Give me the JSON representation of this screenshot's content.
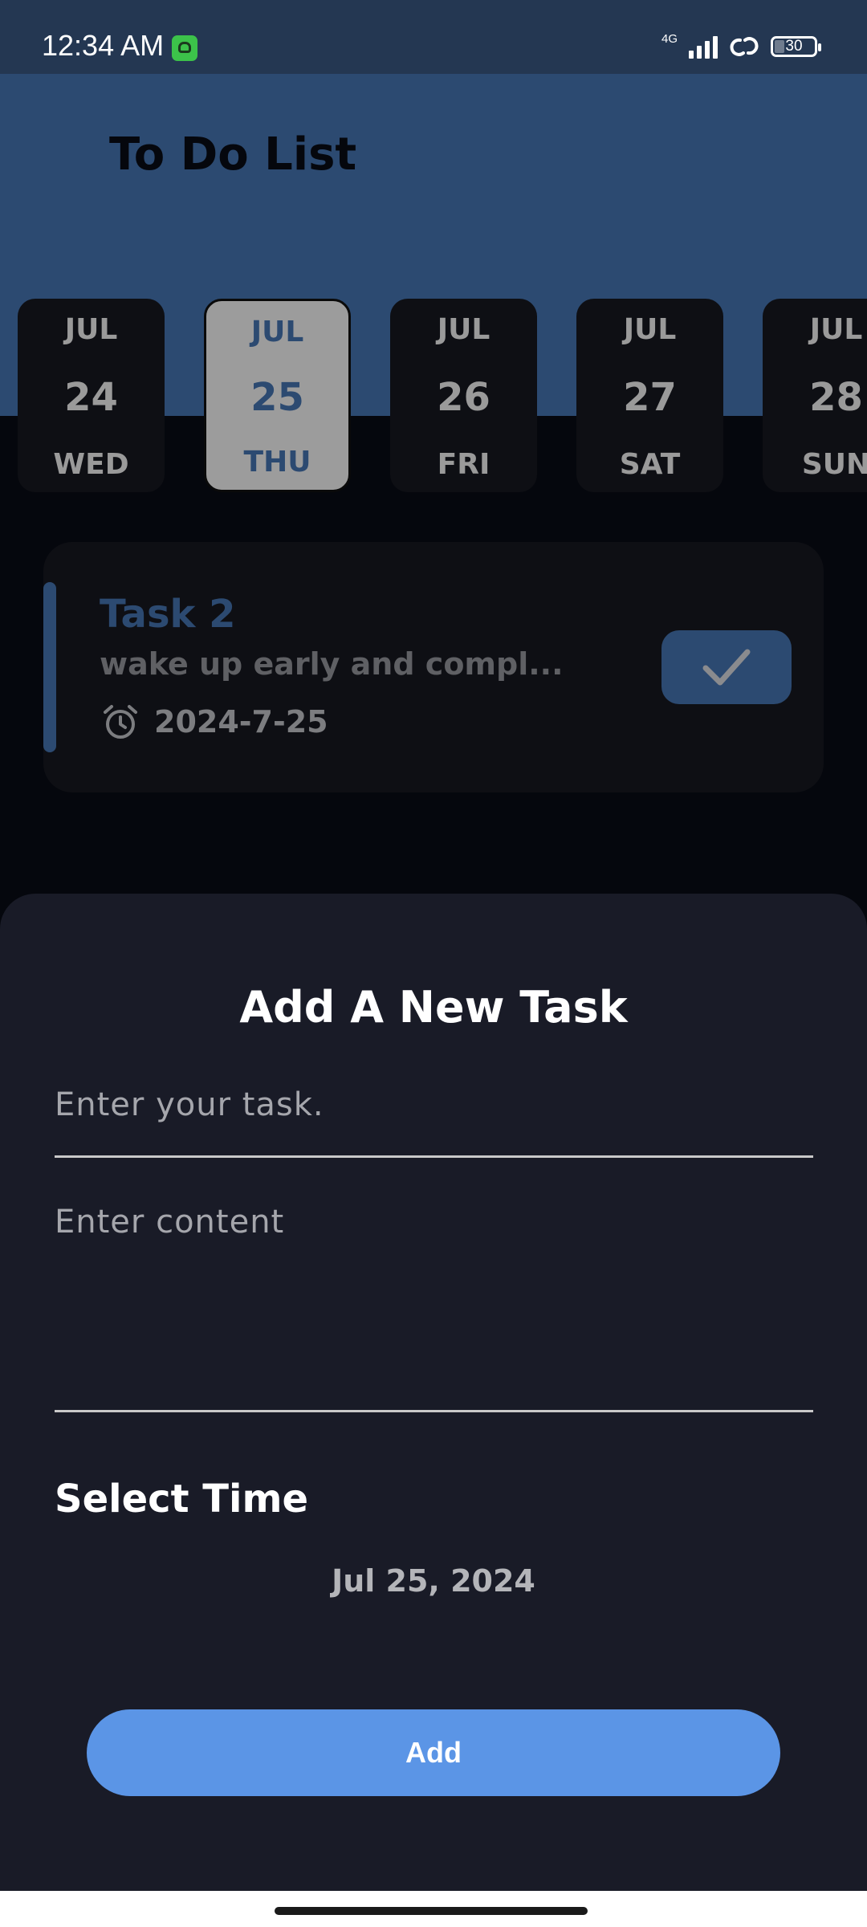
{
  "status_bar": {
    "time": "12:34 AM",
    "network": "4G",
    "battery": "30",
    "icons": [
      "app-notification-icon",
      "signal-icon",
      "link-icon",
      "battery-icon"
    ]
  },
  "header": {
    "title": "To Do List"
  },
  "dates": [
    {
      "month": "JUL",
      "day": "24",
      "weekday": "WED",
      "selected": false
    },
    {
      "month": "JUL",
      "day": "25",
      "weekday": "THU",
      "selected": true
    },
    {
      "month": "JUL",
      "day": "26",
      "weekday": "FRI",
      "selected": false
    },
    {
      "month": "JUL",
      "day": "27",
      "weekday": "SAT",
      "selected": false
    },
    {
      "month": "JUL",
      "day": "28",
      "weekday": "SUN",
      "selected": false
    }
  ],
  "task": {
    "title": "Task 2",
    "content": "wake up early and compl...",
    "time": "2024-7-25",
    "icons": [
      "alarm-clock-icon",
      "check-icon"
    ]
  },
  "sheet": {
    "title": "Add A New Task",
    "task_placeholder": "Enter your task.",
    "content_placeholder": "Enter content",
    "time_label": "Select Time",
    "date_value": "Jul 25, 2024",
    "add_label": "Add"
  },
  "colors": {
    "accent": "#2c4a71",
    "button": "#5b95e6",
    "sheet_background": "#191b27",
    "page_background": "#05070d",
    "status_bar": "#243752"
  }
}
